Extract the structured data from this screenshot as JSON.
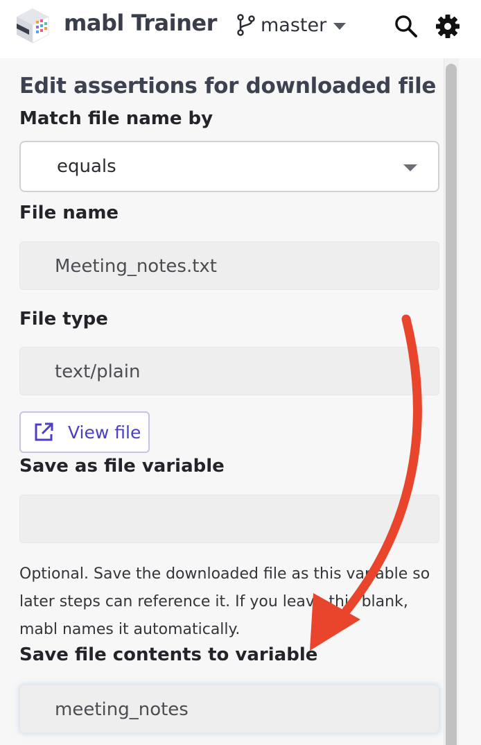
{
  "app": {
    "title": "mabl Trainer",
    "branch": "master"
  },
  "icons": {
    "logo": "mabl-logo-icon",
    "branch": "git-branch-icon",
    "search": "search-icon",
    "settings": "gear-icon",
    "open": "open-external-icon"
  },
  "colors": {
    "accent": "#4a3ec6",
    "annotation_arrow": "#e8452c",
    "input_bg": "#eeeeee"
  },
  "form": {
    "heading": "Edit assertions for downloaded file",
    "match_label": "Match file name by",
    "match_value": "equals",
    "file_name_label": "File name",
    "file_name_value": "Meeting_notes.txt",
    "file_type_label": "File type",
    "file_type_value": "text/plain",
    "view_file_label": "View file",
    "save_file_var_label": "Save as file variable",
    "save_file_var_value": "",
    "help_text": "Optional. Save the downloaded file as this variable so later steps can reference it. If you leave this blank, mabl names it automatically.",
    "save_contents_label": "Save file contents to variable",
    "save_contents_value": "meeting_notes"
  }
}
